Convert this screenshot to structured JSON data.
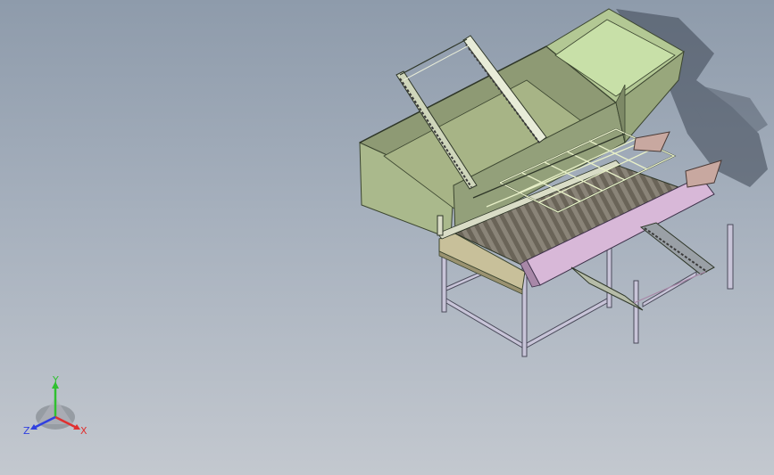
{
  "viewport": {
    "background_top": "#8e9bab",
    "background_bottom": "#c3c8cf"
  },
  "model": {
    "hopper_color": "#b7c39a",
    "hopper_dark": "#8e9a74",
    "chute_color": "#c8e0a8",
    "roller_color": "#7a7468",
    "guard_color": "#d8b8d8",
    "frame_color": "#c8c4d8",
    "wire_color": "#e8f0c8",
    "pan_color": "#b8b08a",
    "flap_color": "#c8a8a0"
  },
  "triad": {
    "x_label": "X",
    "y_label": "Y",
    "z_label": "Z",
    "x_color": "#e03030",
    "y_color": "#30c030",
    "z_color": "#3040e0"
  }
}
